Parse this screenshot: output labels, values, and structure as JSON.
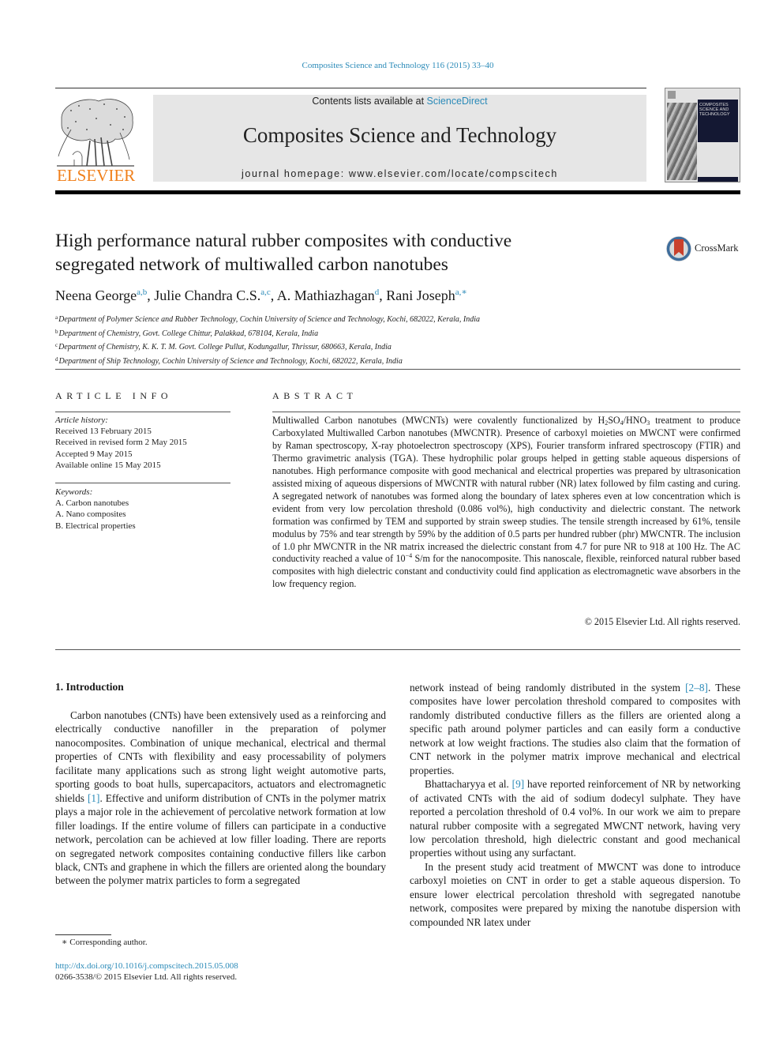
{
  "journal_ref": "Composites Science and Technology 116 (2015) 33–40",
  "header": {
    "contents_prefix": "Contents lists available at ",
    "contents_link": "ScienceDirect",
    "journal_title": "Composites Science and Technology",
    "homepage_label": "journal homepage: www.elsevier.com/locate/compscitech",
    "publisher_logo_text": "ELSEVIER",
    "cover_text": "COMPOSITES SCIENCE AND TECHNOLOGY",
    "brand_color": "#f07f1a",
    "link_color": "#2a8ab8"
  },
  "article": {
    "title_line1": "High performance natural rubber composites with conductive",
    "title_line2": "segregated network of multiwalled carbon nanotubes",
    "crossmark_label": "CrossMark",
    "authors": [
      {
        "name": "Neena George",
        "sup": "a,b",
        "sep": ", "
      },
      {
        "name": "Julie Chandra C.S.",
        "sup": "a,c",
        "sep": ", "
      },
      {
        "name": "A. Mathiazhagan",
        "sup": "d",
        "sep": ", "
      },
      {
        "name": "Rani Joseph",
        "sup": "a,∗",
        "sep": ""
      }
    ],
    "affiliations": [
      {
        "key": "a",
        "text": "Department of Polymer Science and Rubber Technology, Cochin University of Science and Technology, Kochi, 682022, Kerala, India"
      },
      {
        "key": "b",
        "text": "Department of Chemistry, Govt. College Chittur, Palakkad, 678104, Kerala, India"
      },
      {
        "key": "c",
        "text": "Department of Chemistry, K. K. T. M. Govt. College Pullut, Kodungallur, Thrissur, 680663, Kerala, India"
      },
      {
        "key": "d",
        "text": "Department of Ship Technology, Cochin University of Science and Technology, Kochi, 682022, Kerala, India"
      }
    ]
  },
  "article_info": {
    "heading": "ARTICLE INFO",
    "history_label": "Article history:",
    "history": [
      "Received 13 February 2015",
      "Received in revised form 2 May 2015",
      "Accepted 9 May 2015",
      "Available online 15 May 2015"
    ],
    "keywords_label": "Keywords:",
    "keywords": [
      "A. Carbon nanotubes",
      "A. Nano composites",
      "B. Electrical properties"
    ]
  },
  "abstract": {
    "heading": "ABSTRACT",
    "part1": "Multiwalled Carbon nanotubes (MWCNTs) were covalently functionalized by H",
    "sub1": "2",
    "part2": "SO",
    "sub2": "4",
    "part3": "/HNO",
    "sub3": "3",
    "part4": " treatment to produce Carboxylated Multiwalled Carbon nanotubes (MWCNTR). Presence of carboxyl moieties on MWCNT were confirmed by Raman spectroscopy, X-ray photoelectron spectroscopy (XPS), Fourier transform infrared spectroscopy (FTIR) and Thermo gravimetric analysis (TGA). These hydrophilic polar groups helped in getting stable aqueous dispersions of nanotubes. High performance composite with good mechanical and electrical properties was prepared by ultrasonication assisted mixing of aqueous dispersions of MWCNTR with natural rubber (NR) latex followed by film casting and curing. A segregated network of nanotubes was formed along the boundary of latex spheres even at low concentration which is evident from very low percolation threshold (0.086 vol%), high conductivity and dielectric constant. The network formation was confirmed by TEM and supported by strain sweep studies. The tensile strength increased by 61%, tensile modulus by 75% and tear strength by 59% by the addition of 0.5 parts per hundred rubber (phr) MWCNTR. The inclusion of 1.0 phr MWCNTR in the NR matrix increased the dielectric constant from 4.7 for pure NR to 918 at 100 Hz. The AC conductivity reached a value of 10",
    "sup1": "−4",
    "part5": " S/m for the nanocomposite. This nanoscale, flexible, reinforced natural rubber based composites with high dielectric constant and conductivity could find application as electromagnetic wave absorbers in the low frequency region.",
    "copyright": "© 2015 Elsevier Ltd. All rights reserved."
  },
  "introduction": {
    "heading": "1. Introduction",
    "left_p1_a": "Carbon nanotubes (CNTs) have been extensively used as a reinforcing and electrically conductive nanofiller in the preparation of polymer nanocomposites. Combination of unique mechanical, electrical and thermal properties of CNTs with flexibility and easy processability of polymers facilitate many applications such as strong light weight automotive parts, sporting goods to boat hulls, supercapacitors, actuators and electromagnetic shields ",
    "ref1": "[1]",
    "left_p1_b": ". Effective and uniform distribution of CNTs in the polymer matrix plays a major role in the achievement of percolative network formation at low filler loadings. If the entire volume of fillers can participate in a conductive network, percolation can be achieved at low filler loading. There are reports on segregated network composites containing conductive fillers like carbon black, CNTs and graphene in which the fillers are oriented along the boundary between the polymer matrix particles to form a segregated",
    "right_p1_a": "network instead of being randomly distributed in the system ",
    "ref2": "[2–8]",
    "right_p1_b": ". These composites have lower percolation threshold compared to composites with randomly distributed conductive fillers as the fillers are oriented along a specific path around polymer particles and can easily form a conductive network at low weight fractions. The studies also claim that the formation of CNT network in the polymer matrix improve mechanical and electrical properties.",
    "right_p2_a": "Bhattacharyya et al. ",
    "ref3": "[9]",
    "right_p2_b": " have reported reinforcement of NR by networking of activated CNTs with the aid of sodium dodecyl sulphate. They have reported a percolation threshold of 0.4 vol%. In our work we aim to prepare natural rubber composite with a segregated MWCNT network, having very low percolation threshold, high dielectric constant and good mechanical properties without using any surfactant.",
    "right_p3": "In the present study acid treatment of MWCNT was done to introduce carboxyl moieties on CNT in order to get a stable aqueous dispersion. To ensure lower electrical percolation threshold with segregated nanotube network, composites were prepared by mixing the nanotube dispersion with compounded NR latex under"
  },
  "footer": {
    "footnote": "∗  Corresponding author.",
    "doi": "http://dx.doi.org/10.1016/j.compscitech.2015.05.008",
    "issn": "0266-3538/© 2015 Elsevier Ltd. All rights reserved."
  }
}
